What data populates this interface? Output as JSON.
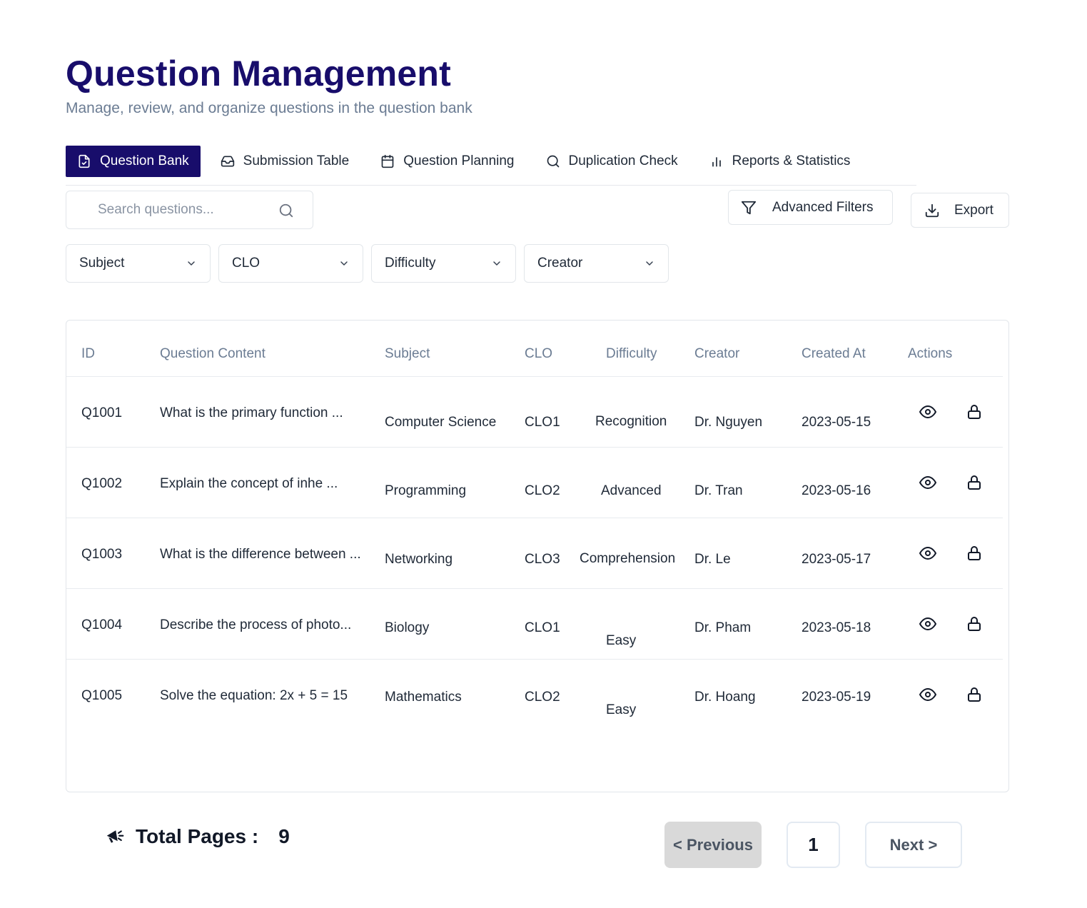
{
  "header": {
    "title": "Question Management",
    "subtitle": "Manage, review, and organize questions in the question bank"
  },
  "tabs": [
    {
      "label": "Question Bank",
      "icon": "file-check-icon",
      "active": true
    },
    {
      "label": "Submission Table",
      "icon": "inbox-icon",
      "active": false
    },
    {
      "label": "Question Planning",
      "icon": "calendar-icon",
      "active": false
    },
    {
      "label": "Duplication Check",
      "icon": "search-icon",
      "active": false
    },
    {
      "label": "Reports & Statistics",
      "icon": "bar-chart-icon",
      "active": false
    }
  ],
  "search": {
    "placeholder": "Search questions...",
    "value": ""
  },
  "toolbar": {
    "advanced_filters_label": "Advanced Filters",
    "export_label": "Export"
  },
  "filters": [
    {
      "label": "Subject"
    },
    {
      "label": "CLO"
    },
    {
      "label": "Difficulty"
    },
    {
      "label": "Creator"
    }
  ],
  "table": {
    "columns": [
      "ID",
      "Question Content",
      "Subject",
      "CLO",
      "Difficulty",
      "Creator",
      "Created At",
      "Actions"
    ],
    "rows": [
      {
        "id": "Q1001",
        "content": "What is the primary function  ...",
        "subject": "Computer Science",
        "clo": "CLO1",
        "difficulty": "Recognition",
        "creator": "Dr. Nguyen",
        "created_at": "2023-05-15"
      },
      {
        "id": "Q1002",
        "content": "Explain the concept of inhe ...",
        "subject": "Programming",
        "clo": "CLO2",
        "difficulty": "Advanced",
        "creator": "Dr. Tran",
        "created_at": "2023-05-16"
      },
      {
        "id": "Q1003",
        "content": "What is the difference between ...",
        "subject": "Networking",
        "clo": "CLO3",
        "difficulty": "Comprehension",
        "creator": "Dr. Le",
        "created_at": "2023-05-17"
      },
      {
        "id": "Q1004",
        "content": "Describe the process of photo...",
        "subject": "Biology",
        "clo": "CLO1",
        "difficulty": "Easy",
        "creator": "Dr. Pham",
        "created_at": "2023-05-18"
      },
      {
        "id": "Q1005",
        "content": "Solve the equation: 2x + 5 = 15",
        "subject": "Mathematics",
        "clo": "CLO2",
        "difficulty": "Easy",
        "creator": "Dr. Hoang",
        "created_at": "2023-05-19"
      }
    ],
    "action_icons": [
      "eye-icon",
      "lock-icon"
    ]
  },
  "footer": {
    "total_pages_label": "Total Pages :",
    "total_pages_value": "9",
    "prev_label": "< Previous",
    "current_page": "1",
    "next_label": "Next  >"
  },
  "colors": {
    "brand": "#180d6b",
    "muted_text": "#6b7c93",
    "border": "#e2e6ea",
    "prev_button_bg": "#d9d9d9"
  }
}
